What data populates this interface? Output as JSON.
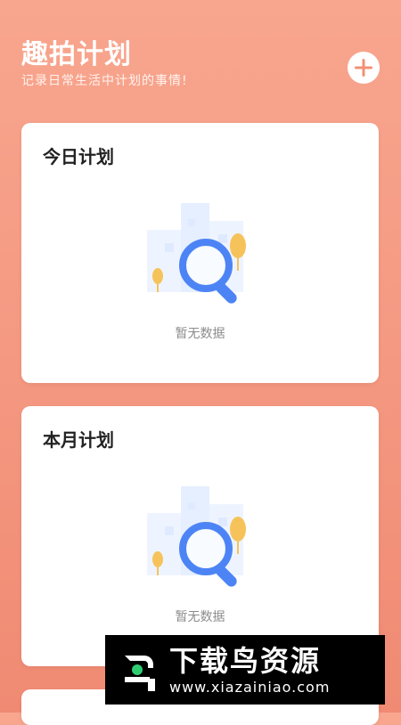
{
  "header": {
    "title": "趣拍计划",
    "subtitle": "记录日常生活中计划的事情!"
  },
  "cards": [
    {
      "title": "今日计划",
      "empty_text": "暂无数据"
    },
    {
      "title": "本月计划",
      "empty_text": "暂无数据"
    }
  ],
  "watermark": {
    "main": "下载鸟资源",
    "url": "www.xiazainiao.com"
  },
  "icons": {
    "add": "plus-icon",
    "empty": "empty-search-illustration",
    "logo": "bird-logo-icon"
  },
  "colors": {
    "background_top": "#f8a68e",
    "background_bottom": "#f08a73",
    "accent_blue": "#4d84f5",
    "tree_yellow": "#f6c35b"
  }
}
